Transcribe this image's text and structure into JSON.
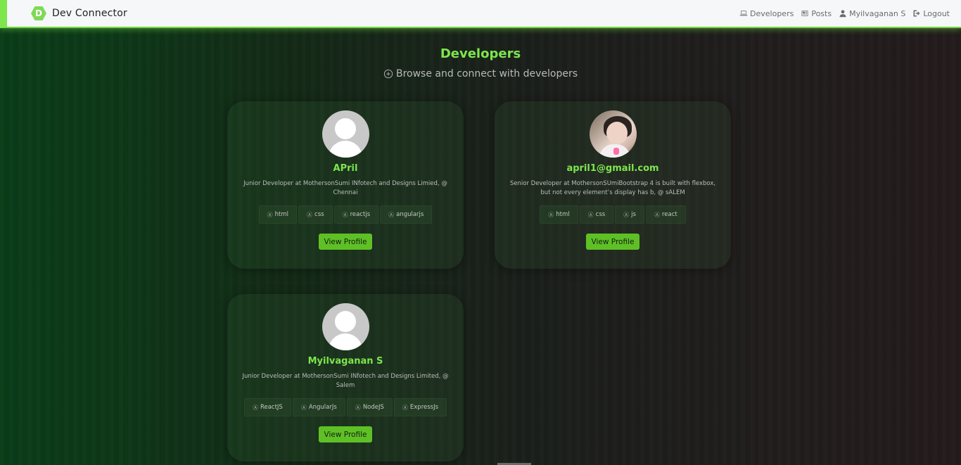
{
  "navbar": {
    "brand_letter": "D",
    "brand": "Dev Connector",
    "links": {
      "developers": "Developers",
      "posts": "Posts",
      "user": "Myilvaganan S",
      "logout": "Logout"
    }
  },
  "page": {
    "title": "Developers",
    "subtitle": "Browse and connect with developers"
  },
  "profiles": [
    {
      "name": "APril",
      "status": "Junior Developer at MothersonSumi INfotech and Designs Limied, @ Chennai",
      "skills": [
        "html",
        "css",
        "reactjs",
        "angularjs"
      ],
      "button": "View Profile"
    },
    {
      "name": "april1@gmail.com",
      "status": "Senior Developer at MothersonSUmiBootstrap 4 is built with flexbox, but not every element’s display has b, @ sALEM",
      "skills": [
        "html",
        "css",
        "js",
        "react"
      ],
      "button": "View Profile"
    },
    {
      "name": "Myilvaganan S",
      "status": "Junior Developer at MothersonSumi INfotech and Designs Limited, @ Salem",
      "skills": [
        "ReactJS",
        "AngularJs",
        "NodeJS",
        "ExpressJs"
      ],
      "button": "View Profile"
    }
  ],
  "skill_icon_glyph": "Ⓐ",
  "colors": {
    "accent": "#7ee64d",
    "button": "#5fc026",
    "navbar_bg": "#f6f7f9"
  }
}
